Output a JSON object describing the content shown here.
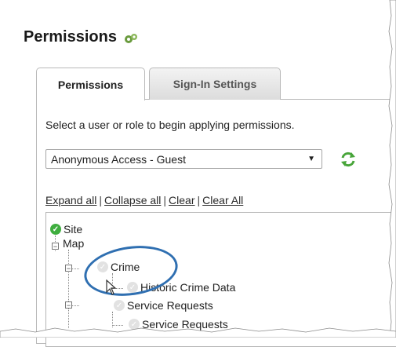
{
  "page": {
    "title": "Permissions"
  },
  "tabs": [
    {
      "label": "Permissions",
      "active": true
    },
    {
      "label": "Sign-In Settings",
      "active": false
    }
  ],
  "instructions": "Select a user or role to begin applying permissions.",
  "user_select": {
    "selected": "Anonymous Access - Guest"
  },
  "links": {
    "expand_all": "Expand all",
    "collapse_all": "Collapse all",
    "clear": "Clear",
    "clear_all": "Clear All",
    "separator": "|"
  },
  "tree": {
    "root": "Site",
    "map": "Map",
    "crime": "Crime",
    "historic": "Historic Crime Data",
    "service_requests_group": "Service Requests",
    "service_requests_item": "Service Requests"
  },
  "colors": {
    "accent_blue": "#2f6fb1",
    "check_green": "#3fae3f",
    "check_gray": "#e2e2e2"
  }
}
